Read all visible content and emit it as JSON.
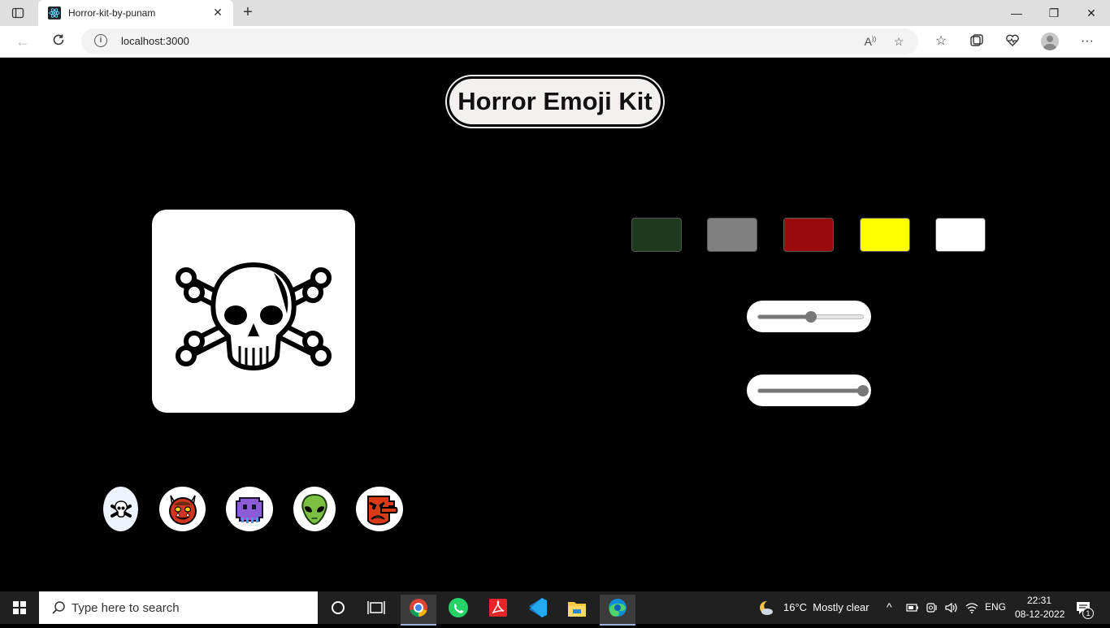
{
  "browser": {
    "tab_title": "Horror-kit-by-punam",
    "url": "localhost:3000"
  },
  "app": {
    "heading": "Horror Emoji Kit",
    "preview_emoji": "skull-and-crossbones",
    "color_swatches": [
      {
        "name": "dark-green",
        "color": "#1e3a1e"
      },
      {
        "name": "gray",
        "color": "#808080"
      },
      {
        "name": "dark-red",
        "color": "#990b0b"
      },
      {
        "name": "yellow",
        "color": "#ffff00"
      },
      {
        "name": "white",
        "color": "#ffffff"
      }
    ],
    "sliders": [
      {
        "name": "size-slider",
        "value_fraction": 0.5
      },
      {
        "name": "opacity-slider",
        "value_fraction": 1.0
      }
    ],
    "emoji_choices": [
      "skull-and-crossbones",
      "ogre",
      "alien-monster",
      "alien",
      "goblin"
    ]
  },
  "taskbar": {
    "search_placeholder": "Type here to search",
    "weather": "16°C  Mostly clear",
    "language": "ENG",
    "time": "22:31",
    "date": "08-12-2022",
    "notification_count": "1"
  }
}
